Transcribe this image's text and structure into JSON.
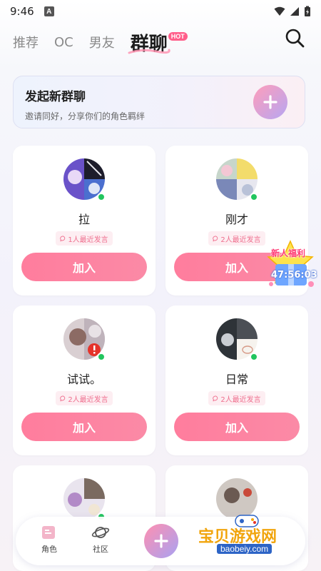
{
  "status_bar": {
    "time": "9:46",
    "notif_icon_label": "A"
  },
  "top_tabs": [
    {
      "label": "推荐",
      "active": false
    },
    {
      "label": "OC",
      "active": false
    },
    {
      "label": "男友",
      "active": false
    },
    {
      "label": "群聊",
      "active": true
    }
  ],
  "hot_badge": "HOT",
  "create_group": {
    "title": "发起新群聊",
    "subtitle": "邀请同好，分享你们的角色羁绊"
  },
  "groups": [
    {
      "name": "拉",
      "activity": "1人最近发言",
      "join_label": "加入"
    },
    {
      "name": "刚才",
      "activity": "2人最近发言",
      "join_label": "加入"
    },
    {
      "name": "试试。",
      "activity": "2人最近发言",
      "join_label": "加入"
    },
    {
      "name": "日常",
      "activity": "2人最近发言",
      "join_label": "加入"
    }
  ],
  "promo": {
    "title": "新人福利",
    "timer": "47:56:03"
  },
  "bottom_nav": {
    "items": [
      {
        "label": "角色"
      },
      {
        "label": "社区"
      }
    ]
  },
  "watermark": {
    "text": "宝贝游戏网",
    "url": "baobeiy.com"
  },
  "colors": {
    "accent_pink": "#ff7d9d",
    "online_green": "#22c55e",
    "hot_pink": "#ff5e8a"
  }
}
